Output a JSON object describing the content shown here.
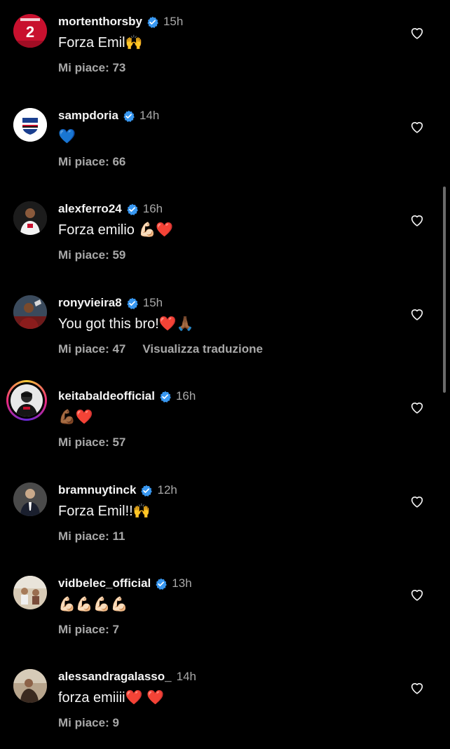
{
  "colors": {
    "background": "#000000",
    "username": "#f5f5f5",
    "secondary": "#a8a8a8",
    "verified": "#3897f0"
  },
  "icons": {
    "verified": "verified-badge-icon",
    "like": "heart-outline-icon"
  },
  "comments": [
    {
      "username": "mortenthorsby",
      "time": "15h",
      "text": "Forza Emil🙌",
      "likes": "Mi piace: 73",
      "translate": ""
    },
    {
      "username": "sampdoria",
      "time": "14h",
      "text": "💙",
      "likes": "Mi piace: 66",
      "translate": ""
    },
    {
      "username": "alexferro24",
      "time": "16h",
      "text": "Forza emilio 💪🏻❤️",
      "likes": "Mi piace: 59",
      "translate": ""
    },
    {
      "username": "ronyvieira8",
      "time": "15h",
      "text": "You got this bro!❤️🙏🏾",
      "likes": "Mi piace: 47",
      "translate": "Visualizza traduzione"
    },
    {
      "username": "keitabaldeofficial",
      "time": "16h",
      "text": "💪🏾❤️",
      "likes": "Mi piace: 57",
      "translate": ""
    },
    {
      "username": "bramnuytinck",
      "time": "12h",
      "text": "Forza Emil!!🙌",
      "likes": "Mi piace: 11",
      "translate": ""
    },
    {
      "username": "vidbelec_official",
      "time": "13h",
      "text": "💪🏻💪🏻💪🏻💪🏻",
      "likes": "Mi piace: 7",
      "translate": ""
    },
    {
      "username": "alessandragalasso_",
      "time": "14h",
      "text": "forza emiiii❤️ ❤️",
      "likes": "Mi piace: 9",
      "translate": ""
    }
  ]
}
